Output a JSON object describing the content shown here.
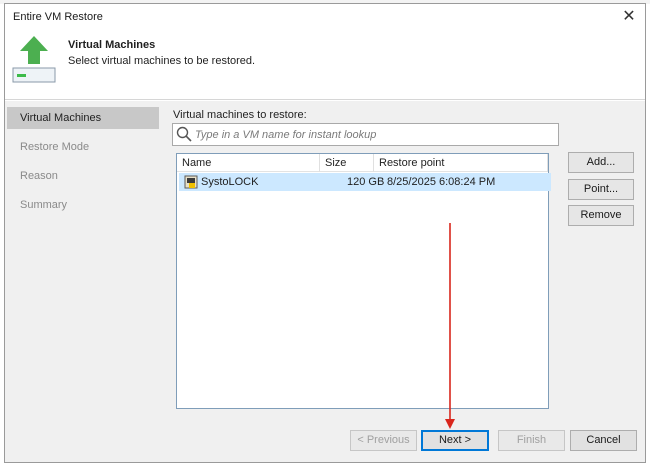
{
  "window": {
    "title": "Entire VM Restore",
    "close_glyph": "✕"
  },
  "header": {
    "title": "Virtual Machines",
    "subtitle": "Select virtual machines to be restored.",
    "icon": "restore-upload-icon"
  },
  "sidebar": {
    "items": [
      {
        "label": "Virtual Machines",
        "active": true
      },
      {
        "label": "Restore Mode",
        "active": false
      },
      {
        "label": "Reason",
        "active": false
      },
      {
        "label": "Summary",
        "active": false
      }
    ]
  },
  "main": {
    "list_label": "Virtual machines to restore:",
    "search": {
      "placeholder": "Type in a VM name for instant lookup",
      "value": ""
    },
    "table": {
      "columns": [
        "Name",
        "Size",
        "Restore point"
      ],
      "rows": [
        {
          "name": "SystoLOCK",
          "size": "120 GB",
          "restore_point": "8/25/2025 6:08:24 PM",
          "selected": true
        }
      ]
    },
    "side_buttons": {
      "add": "Add...",
      "point": "Point...",
      "remove": "Remove"
    }
  },
  "footer": {
    "previous": "< Previous",
    "next": "Next >",
    "finish": "Finish",
    "cancel": "Cancel"
  },
  "colors": {
    "selection": "#cce8ff",
    "accent_arrow": "#d9261c",
    "logo_green": "#4caf50",
    "primary_border": "#0078d7"
  }
}
